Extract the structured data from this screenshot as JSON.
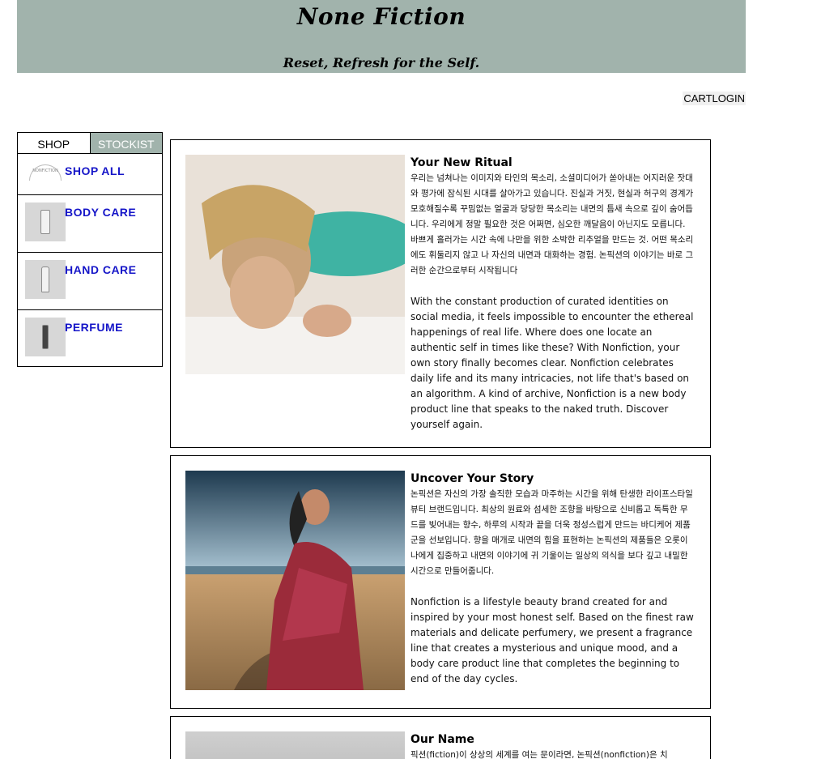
{
  "header": {
    "title": "None Fiction",
    "tagline": "Reset, Refresh for the Self."
  },
  "topnav": {
    "cart": "CART",
    "login": "LOGIN"
  },
  "sidebar": {
    "tabs": [
      "SHOP",
      "STOCKIST"
    ],
    "items": [
      {
        "label": "SHOP ALL",
        "icon": "brand-logo-icon"
      },
      {
        "label": "BODY CARE",
        "icon": "body-wash-bottle-icon"
      },
      {
        "label": "HAND CARE",
        "icon": "hand-cream-tube-icon"
      },
      {
        "label": "PERFUME",
        "icon": "perfume-bottle-icon"
      }
    ]
  },
  "sections": [
    {
      "title": "Your New Ritual",
      "ko": "우리는 넘쳐나는 이미지와 타인의 목소리, 소셜미디어가 쏟아내는 어지러운 잣대와 평가에 잠식된 시대를 살아가고 있습니다. 진실과 거짓, 현실과 허구의 경계가 모호해질수록 꾸밈없는 얼굴과 당당한 목소리는 내면의 틈새 속으로 깊이 숨어듭니다. 우리에게 정말 필요한 것은 어쩌면, 심오한 깨달음이 아닌지도 모릅니다. 바쁘게 흘러가는 시간 속에 나만을 위한 소박한 리추얼을 만드는 것. 어떤 목소리에도 휘둘리지 않고 나 자신의 내면과 대화하는 경험. 논픽션의 이야기는 바로 그러한 순간으로부터 시작됩니다",
      "en": "With the constant production of curated identities on social media, it feels impossible to encounter the ethereal happenings of real life. Where does one locate an authentic self in times like these? With Nonfiction, your own story finally becomes clear. Nonfiction celebrates daily life and its many intricacies, not life that's based on an algorithm. A kind of archive, Nonfiction is a new body product line that speaks to the naked truth. Discover yourself again."
    },
    {
      "title": "Uncover Your Story",
      "ko": "논픽션은 자신의 가장 솔직한 모습과 마주하는 시간을 위해 탄생한 라이프스타일 뷰티 브랜드입니다. 최상의 원료와 섬세한 조향을 바탕으로 신비롭고 독특한 무드를 빚어내는 향수, 하루의 시작과 끝을 더욱 정성스럽게 만드는 바디케어 제품군을 선보입니다. 향을 매개로 내면의 힘을 표현하는 논픽션의 제품들은 오롯이 나에게 집중하고 내면의 이야기에 귀 기울이는 일상의 의식을 보다 깊고 내밀한 시간으로 만들어줍니다.",
      "en": "Nonfiction is a lifestyle beauty brand created for and inspired by your most honest self. Based on the finest raw materials and delicate perfumery, we present a fragrance line that creates a mysterious and unique mood, and a body care product line that completes the beginning to end of the day cycles."
    },
    {
      "title": "Our Name",
      "ko": "픽션(fiction)이 상상의 세계를 여는 문이라면, 논픽션(nonfiction)은 치"
    }
  ]
}
